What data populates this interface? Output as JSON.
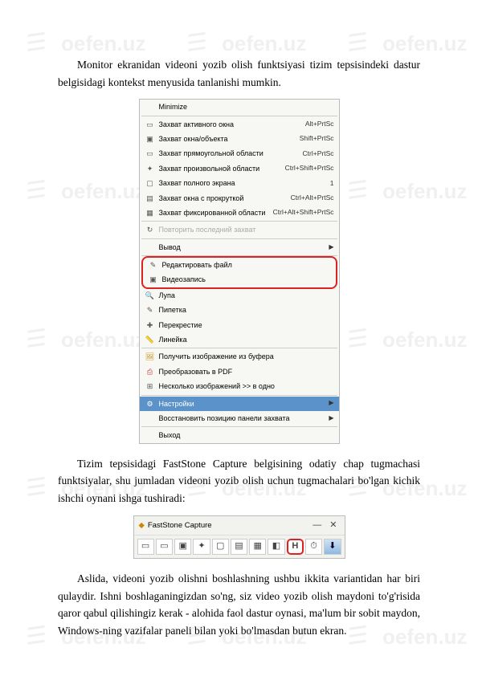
{
  "watermark": "oefen.uz",
  "para1": "Monitor ekranidan videoni yozib olish funktsiyasi tizim tepsisindeki dastur belgisidagi kontekst menyusida tanlanishi mumkin.",
  "para2": "Tizim tepsisidagi FastStone Capture belgisining odatiy chap tugmachasi funktsiyalar, shu jumladan videoni yozib olish uchun tugmachalari bo'lgan kichik ishchi oynani ishga tushiradi:",
  "para3": "Aslida, videoni yozib olishni boshlashning ushbu ikkita variantidan har biri qulaydir. Ishni boshlaganingizdan so'ng, siz video yozib olish maydoni to'g'risida qaror qabul qilishingiz kerak - alohida faol dastur oynasi, ma'lum bir sobit maydon, Windows-ning vazifalar paneli bilan yoki bo'lmasdan butun ekran.",
  "menu": {
    "minimize": "Minimize",
    "items1": [
      {
        "ic": "▭",
        "lbl": "Захват активного окна",
        "sc": "Alt+PrtSc"
      },
      {
        "ic": "▣",
        "lbl": "Захват окна/объекта",
        "sc": "Shift+PrtSc"
      },
      {
        "ic": "▭",
        "lbl": "Захват прямоугольной области",
        "sc": "Ctrl+PrtSc"
      },
      {
        "ic": "✦",
        "lbl": "Захват произвольной области",
        "sc": "Ctrl+Shift+PrtSc"
      },
      {
        "ic": "▢",
        "lbl": "Захват полного экрана",
        "sc": "1"
      },
      {
        "ic": "▤",
        "lbl": "Захват окна с прокруткой",
        "sc": "Ctrl+Alt+PrtSc"
      },
      {
        "ic": "▦",
        "lbl": "Захват фиксированной области",
        "sc": "Ctrl+Alt+Shift+PrtSc"
      }
    ],
    "repeat": "Повторить последний захват",
    "output": "Вывод",
    "edit": "Редактировать файл",
    "record": "Видеозапись",
    "tools": [
      {
        "ic": "🔍",
        "lbl": "Лупа"
      },
      {
        "ic": "✎",
        "lbl": "Пипетка"
      },
      {
        "ic": "✚",
        "lbl": "Перекрестие"
      },
      {
        "ic": "📏",
        "lbl": "Линейка"
      }
    ],
    "clip": "Получить изображение из буфера",
    "pdf": "Преобразовать в PDF",
    "multi": "Несколько изображений >> в одно",
    "settings": "Настройки",
    "restore": "Восстановить позицию панели захвата",
    "exit": "Выход"
  },
  "toolbar": {
    "title": "FastStone Capture",
    "btns": [
      "▭",
      "▭",
      "▣",
      "✦",
      "▢",
      "▤",
      "▦",
      "◧"
    ],
    "video": "H",
    "tail": [
      "⏱",
      "⬇"
    ]
  }
}
